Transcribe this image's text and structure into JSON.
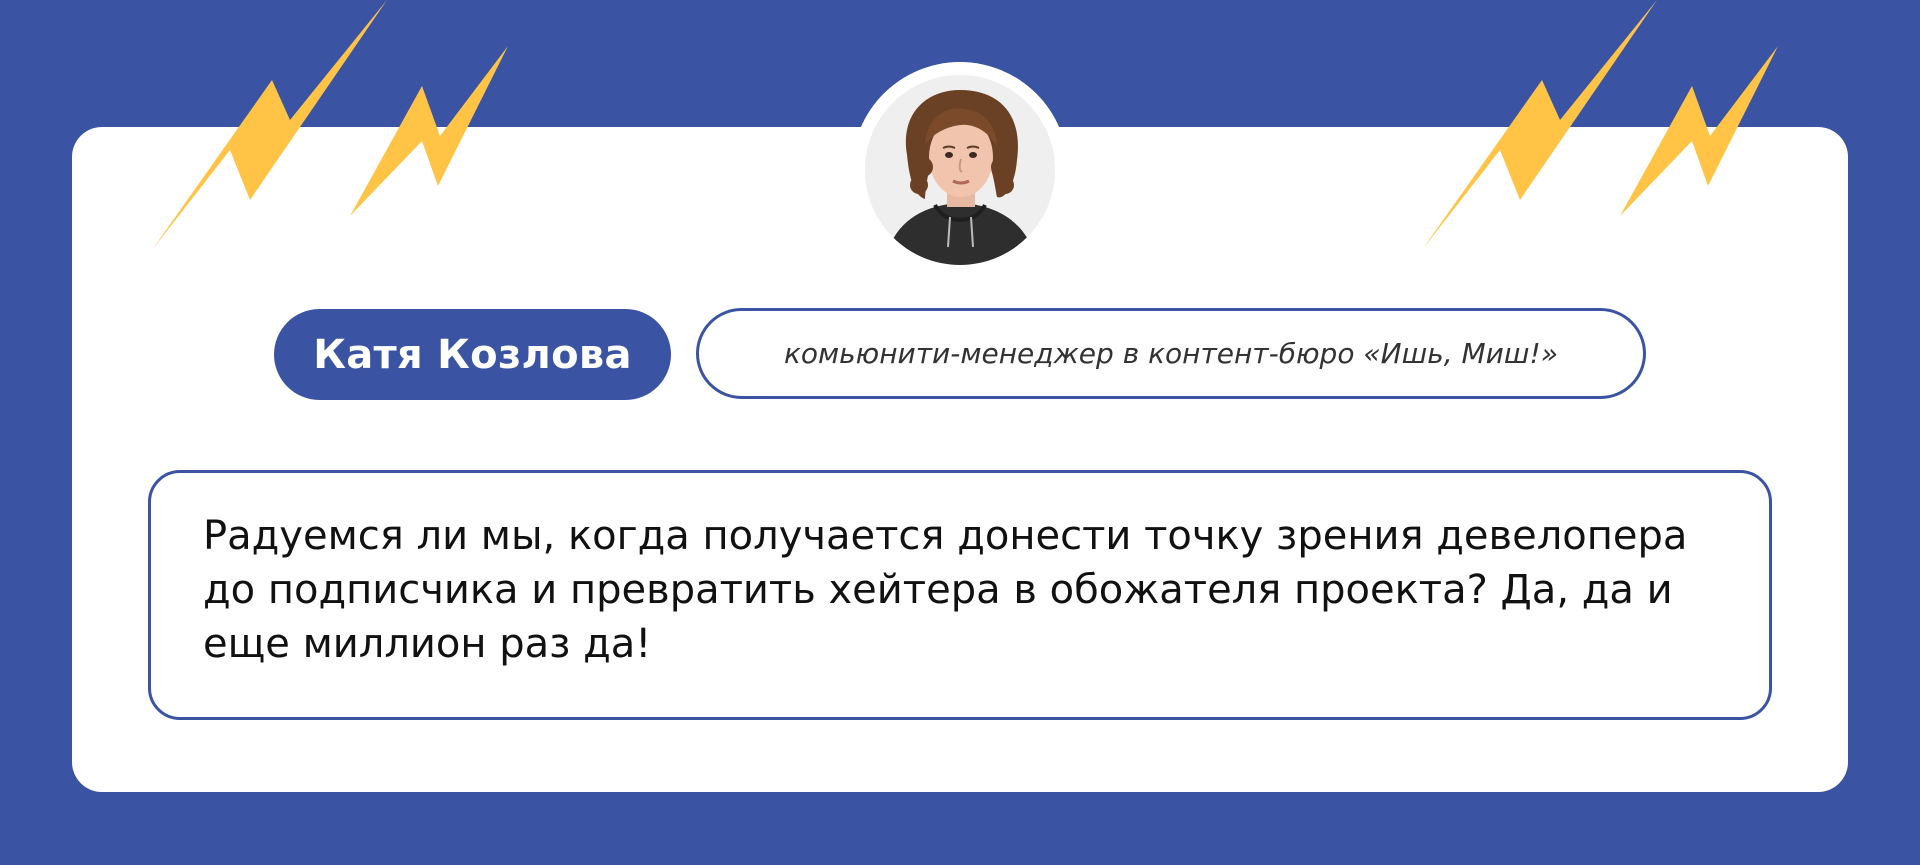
{
  "person": {
    "name": "Катя Козлова",
    "role": "комьюнити-менеджер в контент-бюро «Ишь, Миш!»"
  },
  "quote": {
    "text": "Радуемся ли мы, когда получается донести точку зрения девелопера до подписчика и превратить хейтера в обожателя проекта? Да, да и еще миллион раз да!"
  },
  "colors": {
    "background": "#3A54A3",
    "card": "#FFFFFF",
    "accent_bolt": "#FFC446",
    "text": "#111111"
  },
  "icons": [
    "lightning-icon",
    "lightning-icon",
    "lightning-icon",
    "lightning-icon",
    "portrait-photo"
  ]
}
